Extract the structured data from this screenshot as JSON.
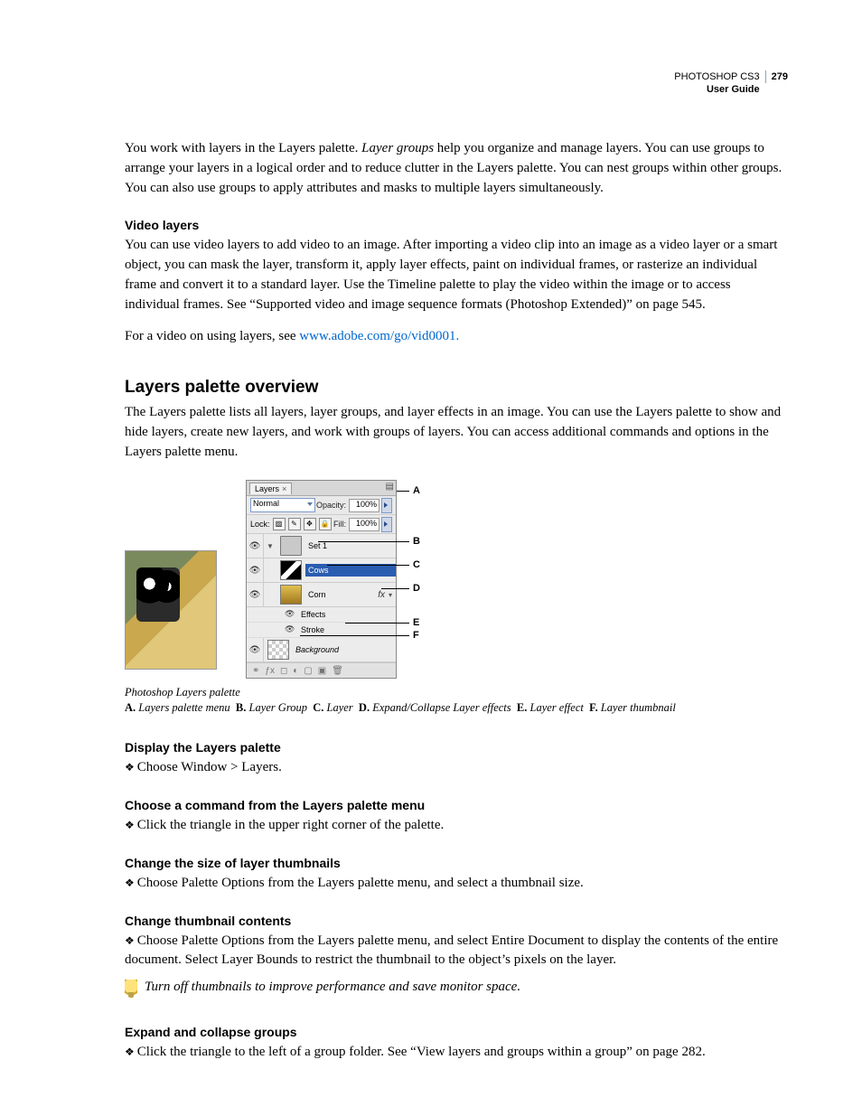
{
  "header": {
    "product": "PHOTOSHOP CS3",
    "guide": "User Guide",
    "page": "279"
  },
  "intro": {
    "p1a": "You work with layers in the Layers palette. ",
    "p1b": "Layer groups",
    "p1c": " help you organize and manage layers. You can use groups to arrange your layers in a logical order and to reduce clutter in the Layers palette. You can nest groups within other groups. You can also use groups to apply attributes and masks to multiple layers simultaneously."
  },
  "video": {
    "h": "Video layers",
    "p": "You can use video layers to add video to an image. After importing a video clip into an image as a video layer or a smart object, you can mask the layer, transform it, apply layer effects, paint on individual frames, or rasterize an individual frame and convert it to a standard layer. Use the Timeline palette to play the video within the image or to access individual frames. See “Supported video and image sequence formats (Photoshop Extended)” on page 545.",
    "link_pre": "For a video on using layers, see ",
    "link": "www.adobe.com/go/vid0001.",
    "link_post": ""
  },
  "overview": {
    "h": "Layers palette overview",
    "p": "The Layers palette lists all layers, layer groups, and layer effects in an image. You can use the Layers palette to show and hide layers, create new layers, and work with groups of layers. You can access additional commands and options in the Layers palette menu."
  },
  "figure": {
    "tab": "Layers",
    "mode": "Normal",
    "opacity_lbl": "Opacity:",
    "opacity_val": "100%",
    "lock_lbl": "Lock:",
    "fill_lbl": "Fill:",
    "fill_val": "100%",
    "set": "Set 1",
    "cows": "Cows",
    "corn": "Corn",
    "effects": "Effects",
    "stroke": "Stroke",
    "bg": "Background",
    "fx": "fx",
    "callouts": {
      "A": "A",
      "B": "B",
      "C": "C",
      "D": "D",
      "E": "E",
      "F": "F"
    },
    "caption_title": "Photoshop Layers palette",
    "legend": {
      "A": "Layers palette menu",
      "B": "Layer Group",
      "C": "Layer",
      "D": "Expand/Collapse Layer effects",
      "E": "Layer effect",
      "F": "Layer thumbnail"
    }
  },
  "sections": {
    "display": {
      "h": "Display the Layers palette",
      "b": "Choose Window > Layers."
    },
    "command": {
      "h": "Choose a command from the Layers palette menu",
      "b": "Click the triangle in the upper right corner of the palette."
    },
    "size": {
      "h": "Change the size of layer thumbnails",
      "b": "Choose Palette Options from the Layers palette menu, and select a thumbnail size."
    },
    "contents": {
      "h": "Change thumbnail contents",
      "b": "Choose Palette Options from the Layers palette menu, and select Entire Document to display the contents of the entire document. Select Layer Bounds to restrict the thumbnail to the object’s pixels on the layer.",
      "tip": "Turn off thumbnails to improve performance and save monitor space."
    },
    "expand": {
      "h": "Expand and collapse groups",
      "b": "Click the triangle to the left of a group folder. See “View layers and groups within a group” on page 282."
    }
  }
}
